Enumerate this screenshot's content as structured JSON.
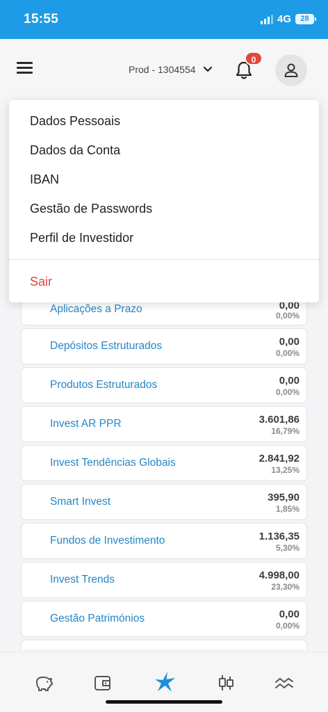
{
  "status_bar": {
    "time": "15:55",
    "network": "4G",
    "battery": "28"
  },
  "header": {
    "account_label": "Prod - 1304554",
    "notification_count": "0"
  },
  "menu": {
    "items": [
      "Dados Pessoais",
      "Dados da Conta",
      "IBAN",
      "Gestão de Passwords",
      "Perfil de Investidor"
    ],
    "logout": "Sair"
  },
  "products": [
    {
      "label": "Aplicações a Prazo",
      "value": "0,00",
      "pct": "0,00%"
    },
    {
      "label": "Depósitos Estruturados",
      "value": "0,00",
      "pct": "0,00%"
    },
    {
      "label": "Produtos Estruturados",
      "value": "0,00",
      "pct": "0,00%"
    },
    {
      "label": "Invest AR PPR",
      "value": "3.601,86",
      "pct": "16,79%"
    },
    {
      "label": "Invest Tendências Globais",
      "value": "2.841,92",
      "pct": "13,25%"
    },
    {
      "label": "Smart Invest",
      "value": "395,90",
      "pct": "1,85%"
    },
    {
      "label": "Fundos de Investimento",
      "value": "1.136,35",
      "pct": "5,30%"
    },
    {
      "label": "Invest Trends",
      "value": "4.998,00",
      "pct": "23,30%"
    },
    {
      "label": "Gestão Patrimónios",
      "value": "0,00",
      "pct": "0,00%"
    }
  ],
  "bottom_nav": {
    "icons": [
      "piggy-bank-icon",
      "wallet-icon",
      "star-logo-icon",
      "candlestick-icon",
      "trend-lines-icon"
    ],
    "active_color": "#1e8fd8"
  },
  "colors": {
    "status_bar": "#1e9be6",
    "link": "#2586c6",
    "logout": "#e0453a",
    "badge": "#e2473b"
  }
}
